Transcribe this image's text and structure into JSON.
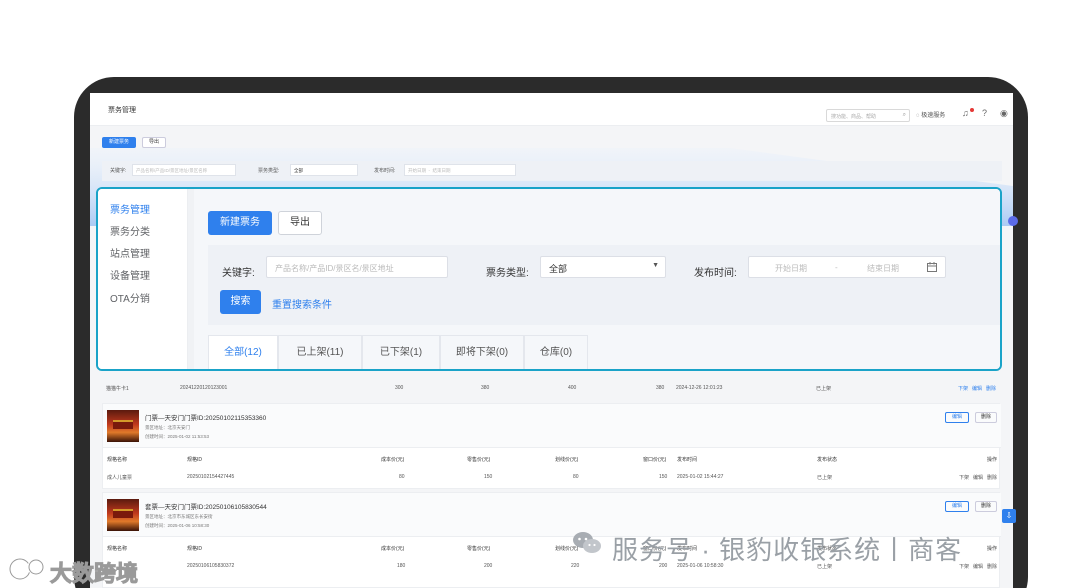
{
  "header": {
    "app_title": "票务管理",
    "search_placeholder": "搜功能、商品、帮助",
    "service_label": "极速服务"
  },
  "mini_toolbar": {
    "primary": "新建票务",
    "secondary": "导出"
  },
  "mini_filter": {
    "keyword_label": "关键字:",
    "keyword_placeholder": "产品名称/产品ID/景区地址/景区名称",
    "type_label": "票务类型:",
    "type_value": "全部",
    "date_label": "发布时间:",
    "date_start": "开始日期",
    "date_sep": "-",
    "date_end": "结束日期"
  },
  "sidebar": {
    "items": [
      {
        "label": "票务管理"
      },
      {
        "label": "票务分类"
      },
      {
        "label": "站点管理"
      },
      {
        "label": "设备管理"
      },
      {
        "label": "OTA分销"
      }
    ]
  },
  "toolbar": {
    "new_label": "新建票务",
    "export_label": "导出"
  },
  "filter": {
    "keyword_label": "关键字:",
    "keyword_placeholder": "产品名称/产品ID/景区名/景区地址",
    "type_label": "票务类型:",
    "type_value": "全部",
    "date_label": "发布时间:",
    "date_start": "开始日期",
    "date_sep": "-",
    "date_end": "结束日期",
    "search_label": "搜索",
    "reset_label": "重置搜索条件"
  },
  "tabs": [
    {
      "label": "全部(12)"
    },
    {
      "label": "已上架(11)"
    },
    {
      "label": "已下架(1)"
    },
    {
      "label": "即将下架(0)"
    },
    {
      "label": "仓库(0)"
    }
  ],
  "list": {
    "top_row": {
      "name": "猫猫牛卡1",
      "id": "20241220120123001",
      "cost": "300",
      "retail": "380",
      "vip": "400",
      "window": "380",
      "time": "2024-12-26 12:01:23",
      "status": "已上架",
      "actions": [
        "下架",
        "编辑",
        "删除"
      ]
    },
    "columns": [
      "规格名称",
      "规格ID",
      "成本价(元)",
      "零售价(元)",
      "划线价(元)",
      "窗口价(元)",
      "发布时间",
      "发布状态",
      "操作"
    ],
    "cards": [
      {
        "title": "门票—天安门门票ID:20250102115353360",
        "address": "景区地址：北京天安门",
        "created": "创建时间：2025-01-02 11:53:53",
        "edit": "编辑",
        "delete": "删除",
        "row": {
          "name": "成人儿童票",
          "id": "20250102154427445",
          "cost": "80",
          "retail": "150",
          "vip": "80",
          "window": "150",
          "time": "2025-01-02 15:44:27",
          "status": "已上架",
          "actions": [
            "下架",
            "编辑",
            "删除"
          ]
        }
      },
      {
        "title": "套票—天安门门票ID:20250106105830544",
        "address": "景区地址：北京市东城区东长安街",
        "created": "创建时间：2025-01-06 10:58:30",
        "edit": "编辑",
        "delete": "删除",
        "row": {
          "name": "",
          "id": "20250106105830372",
          "cost": "180",
          "retail": "200",
          "vip": "220",
          "window": "200",
          "time": "2025-01-06 10:58:30",
          "status": "已上架",
          "actions": [
            "下架",
            "编辑",
            "删除"
          ]
        }
      }
    ]
  },
  "watermark": {
    "text": "服务号 · 银豹收银系统丨商客"
  },
  "corner_logo": {
    "text": "大数跨境"
  },
  "colors": {
    "primary": "#2f80ed",
    "highlight_border": "#1aa3c8",
    "frame": "#2b2b2b"
  }
}
